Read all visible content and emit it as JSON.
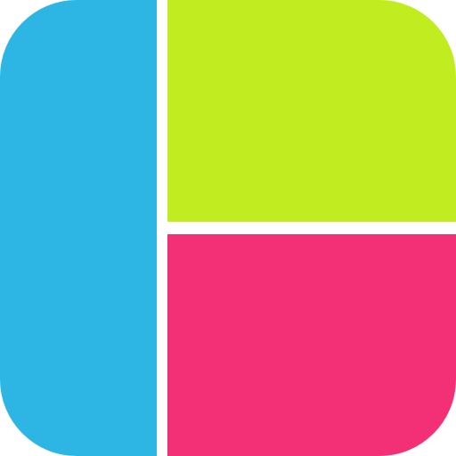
{
  "icon": {
    "name": "collage-layout-app-icon",
    "background_color": "#ffffff",
    "panels": {
      "left": {
        "color": "#2db6e4"
      },
      "top_right": {
        "color": "#c1ec1f"
      },
      "bottom_right": {
        "color": "#f32f76"
      }
    }
  }
}
